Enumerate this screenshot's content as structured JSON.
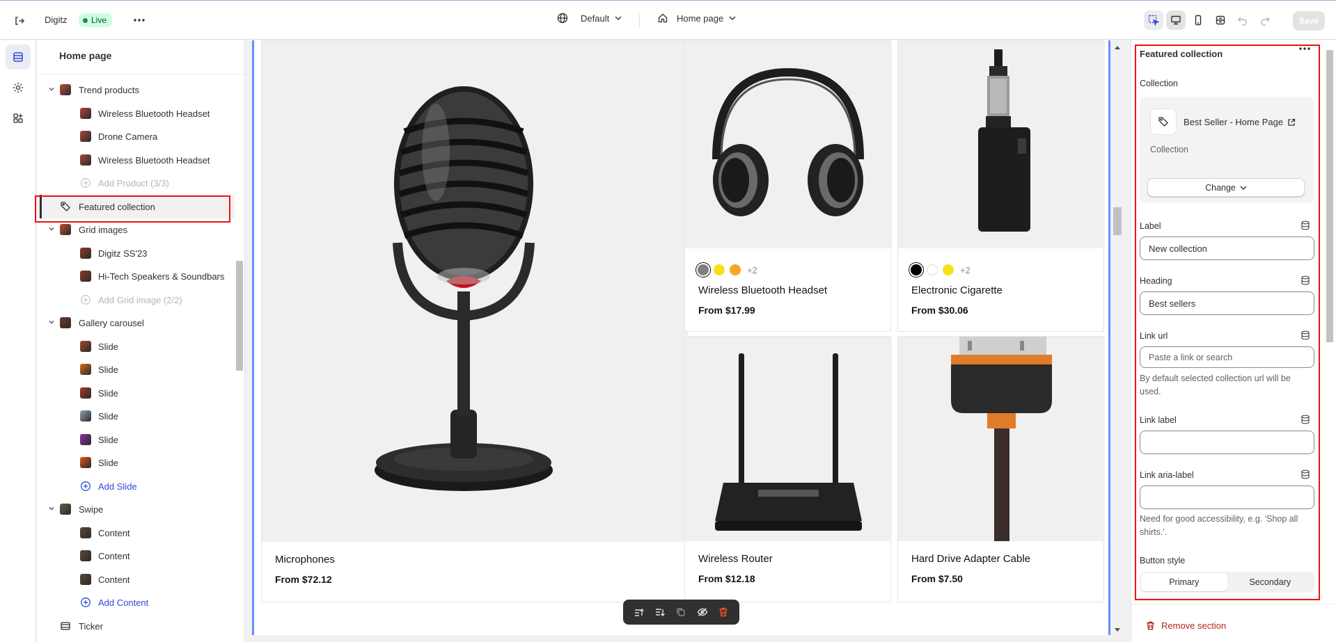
{
  "topbar": {
    "store_name": "Digitz",
    "live_badge": "Live",
    "theme": "Default",
    "page": "Home page",
    "save": "Save"
  },
  "sidebar": {
    "title": "Home page",
    "rows": [
      {
        "label": "Trend products",
        "level": 0,
        "expanded": true,
        "icon": "trend-products-thumb"
      },
      {
        "label": "Wireless Bluetooth Headset",
        "level": 1,
        "icon": "product-thumb"
      },
      {
        "label": "Drone Camera",
        "level": 1,
        "icon": "product-thumb"
      },
      {
        "label": "Wireless Bluetooth Headset",
        "level": 1,
        "icon": "product-thumb"
      },
      {
        "label": "Add Product (3/3)",
        "level": 1,
        "style": "muted",
        "icon": "plus-circle-icon"
      },
      {
        "label": "Featured collection",
        "level": 0,
        "selected": true,
        "icon": "tag-icon"
      },
      {
        "label": "Grid images",
        "level": 0,
        "expanded": true,
        "icon": "grid-images-thumb"
      },
      {
        "label": "Digitz SS'23",
        "level": 1,
        "icon": "image-thumb"
      },
      {
        "label": "Hi-Tech Speakers & Soundbars",
        "level": 1,
        "icon": "image-thumb"
      },
      {
        "label": "Add Grid image (2/2)",
        "level": 1,
        "style": "muted",
        "icon": "plus-circle-icon"
      },
      {
        "label": "Gallery carousel",
        "level": 0,
        "expanded": true,
        "icon": "gallery-thumb"
      },
      {
        "label": "Slide",
        "level": 1,
        "icon": "slide-thumb"
      },
      {
        "label": "Slide",
        "level": 1,
        "icon": "slide-thumb"
      },
      {
        "label": "Slide",
        "level": 1,
        "icon": "slide-thumb"
      },
      {
        "label": "Slide",
        "level": 1,
        "icon": "slide-thumb"
      },
      {
        "label": "Slide",
        "level": 1,
        "icon": "slide-thumb"
      },
      {
        "label": "Slide",
        "level": 1,
        "icon": "slide-thumb"
      },
      {
        "label": "Add Slide",
        "level": 1,
        "style": "blue",
        "icon": "plus-circle-icon"
      },
      {
        "label": "Swipe",
        "level": 0,
        "expanded": true,
        "icon": "swipe-thumb"
      },
      {
        "label": "Content",
        "level": 1,
        "icon": "content-thumb"
      },
      {
        "label": "Content",
        "level": 1,
        "icon": "content-thumb"
      },
      {
        "label": "Content",
        "level": 1,
        "icon": "content-thumb"
      },
      {
        "label": "Add Content",
        "level": 1,
        "style": "blue",
        "icon": "plus-circle-icon"
      },
      {
        "label": "Ticker",
        "level": 0,
        "icon": "ticker-icon"
      }
    ]
  },
  "preview": {
    "products": [
      {
        "name": "Microphones",
        "price": "From $72.12"
      },
      {
        "name": "Wireless Bluetooth Headset",
        "price": "From $17.99",
        "swatches": [
          "#808080",
          "#f5e21b",
          "#f5a623"
        ],
        "more": "+2"
      },
      {
        "name": "Electronic Cigarette",
        "price": "From $30.06",
        "swatches": [
          "#000000",
          "#ffffff",
          "#f5e21b"
        ],
        "more": "+2"
      },
      {
        "name": "Wireless Router",
        "price": "From $12.18"
      },
      {
        "name": "Hard Drive Adapter Cable",
        "price": "From $7.50"
      }
    ]
  },
  "panel": {
    "title": "Featured collection",
    "collection_label": "Collection",
    "collection_name": "Best Seller - Home Page",
    "collection_sub": "Collection",
    "change_button": "Change",
    "label_label": "Label",
    "label_value": "New collection",
    "heading_label": "Heading",
    "heading_value": "Best sellers",
    "link_url_label": "Link url",
    "link_url_placeholder": "Paste a link or search",
    "link_url_help": "By default selected collection url will be used.",
    "link_label_label": "Link label",
    "link_label_value": "",
    "aria_label_label": "Link aria-label",
    "aria_label_value": "",
    "aria_help": "Need for good accessibility, e.g. 'Shop all shirts.'.",
    "button_style_label": "Button style",
    "button_style_options": [
      "Primary",
      "Secondary"
    ],
    "button_style_selected": "Primary",
    "remove_section": "Remove section"
  },
  "colors": {
    "accent_blue": "#2c49d8",
    "live_green": "#cdfee1",
    "highlight_red": "#ee1111",
    "preview_border": "#6b8dfc"
  }
}
